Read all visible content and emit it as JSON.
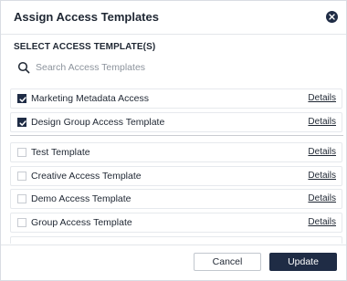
{
  "dialog": {
    "title": "Assign Access Templates",
    "section_label": "SELECT ACCESS TEMPLATE(S)"
  },
  "search": {
    "placeholder": "Search Access Templates",
    "value": ""
  },
  "templates": [
    {
      "label": "Marketing Metadata Access",
      "checked": true,
      "details_label": "Details"
    },
    {
      "label": "Design Group Access Template",
      "checked": true,
      "details_label": "Details"
    },
    {
      "label": "Test Template",
      "checked": false,
      "details_label": "Details"
    },
    {
      "label": "Creative Access Template",
      "checked": false,
      "details_label": "Details"
    },
    {
      "label": "Demo Access Template",
      "checked": false,
      "details_label": "Details"
    },
    {
      "label": "Group Access Template",
      "checked": false,
      "details_label": "Details"
    }
  ],
  "footer": {
    "cancel_label": "Cancel",
    "update_label": "Update"
  },
  "colors": {
    "primary": "#1f2c45",
    "border": "#e6e9ed",
    "text": "#1f2733",
    "placeholder": "#8c939c"
  },
  "icons": {
    "close": "close-icon",
    "search": "search-icon",
    "checkbox_checked": "checkmark-icon"
  }
}
